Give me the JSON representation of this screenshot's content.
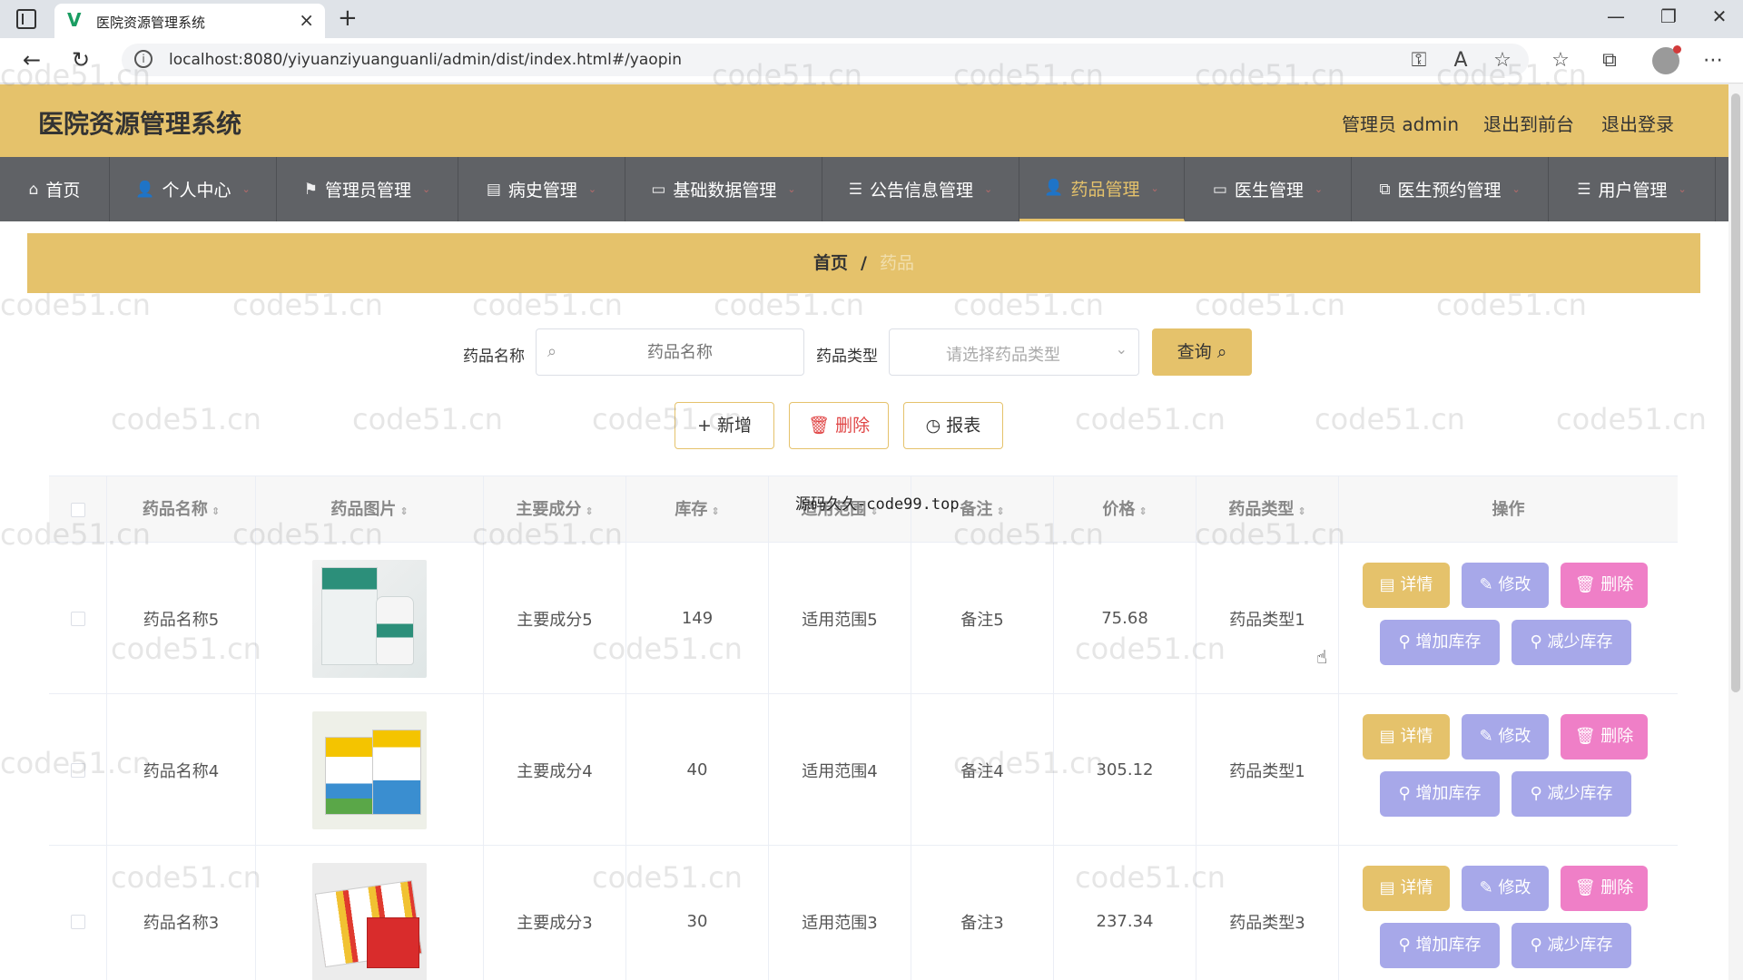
{
  "browser": {
    "tab_title": "医院资源管理系统",
    "tab_close": "×",
    "new_tab": "+",
    "url": "localhost:8080/yiyuanziyuanguanli/admin/dist/index.html#/yaopin",
    "window_controls": [
      "—",
      "❐",
      "✕"
    ]
  },
  "header": {
    "title": "医院资源管理系统",
    "admin_label": "管理员 admin",
    "back_to_front": "退出到前台",
    "logout": "退出登录",
    "accent_color": "#e5c26b"
  },
  "nav": {
    "items": [
      {
        "label": "首页",
        "icon": "home-icon"
      },
      {
        "label": "个人中心",
        "icon": "user-icon"
      },
      {
        "label": "管理员管理",
        "icon": "flag-icon"
      },
      {
        "label": "病史管理",
        "icon": "document-icon"
      },
      {
        "label": "基础数据管理",
        "icon": "monitor-icon"
      },
      {
        "label": "公告信息管理",
        "icon": "list-icon"
      },
      {
        "label": "药品管理",
        "icon": "user-icon",
        "active": true
      },
      {
        "label": "医生管理",
        "icon": "monitor-icon"
      },
      {
        "label": "医生预约管理",
        "icon": "copy-icon"
      },
      {
        "label": "用户管理",
        "icon": "list-icon"
      }
    ]
  },
  "breadcrumb": {
    "home": "首页",
    "separator": "/",
    "current": "药品"
  },
  "search": {
    "name_label": "药品名称",
    "name_placeholder": "药品名称",
    "type_label": "药品类型",
    "type_placeholder": "请选择药品类型",
    "query_button": "查询"
  },
  "actions": {
    "add": "新增",
    "delete": "删除",
    "report": "报表"
  },
  "overlay_text": "源码久久-code99.top",
  "table": {
    "columns": [
      "药品名称",
      "药品图片",
      "主要成分",
      "库存",
      "适用范围",
      "备注",
      "价格",
      "药品类型",
      "操作"
    ],
    "rows": [
      {
        "name": "药品名称5",
        "ingredient": "主要成分5",
        "stock": "149",
        "scope": "适用范围5",
        "note": "备注5",
        "price": "75.68",
        "type": "药品类型1"
      },
      {
        "name": "药品名称4",
        "ingredient": "主要成分4",
        "stock": "40",
        "scope": "适用范围4",
        "note": "备注4",
        "price": "305.12",
        "type": "药品类型1"
      },
      {
        "name": "药品名称3",
        "ingredient": "主要成分3",
        "stock": "30",
        "scope": "适用范围3",
        "note": "备注3",
        "price": "237.34",
        "type": "药品类型3"
      }
    ],
    "row_actions": {
      "detail": "详情",
      "edit": "修改",
      "delete": "删除",
      "add_stock": "增加库存",
      "reduce_stock": "减少库存"
    }
  },
  "watermark_text": "code51.cn"
}
